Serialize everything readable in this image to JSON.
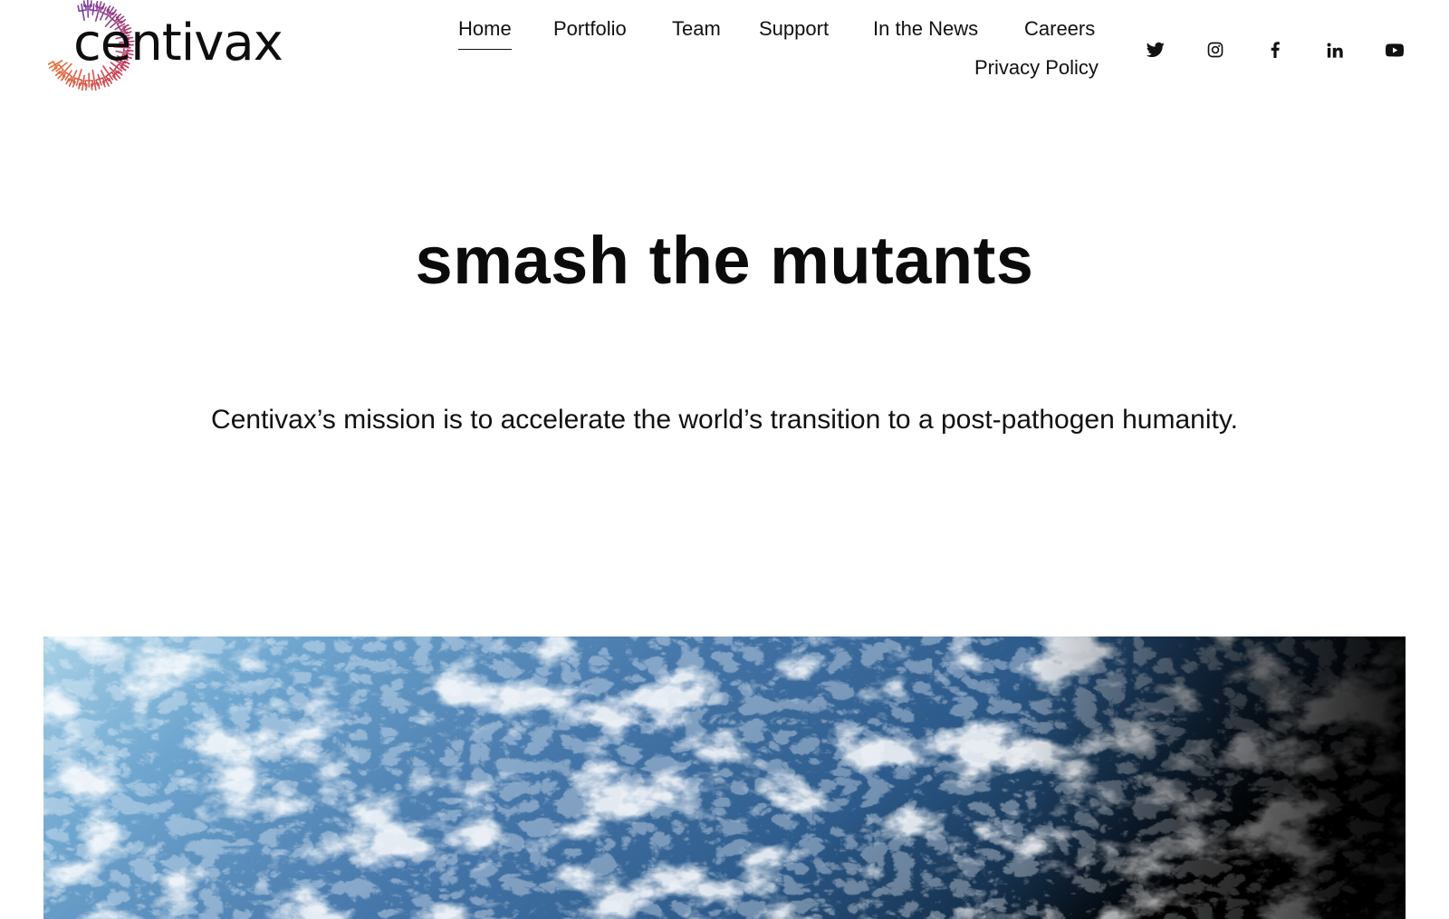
{
  "brand": {
    "name": "centivax"
  },
  "nav": {
    "items": [
      {
        "label": "Home",
        "active": true
      },
      {
        "label": "Portfolio"
      },
      {
        "label": "Team"
      },
      {
        "label": "Support"
      },
      {
        "label": "In the News"
      },
      {
        "label": "Careers"
      },
      {
        "label": "Privacy Policy"
      }
    ]
  },
  "social": [
    "twitter-icon",
    "instagram-icon",
    "facebook-icon",
    "linkedin-icon",
    "youtube-icon"
  ],
  "hero": {
    "title": "smash the mutants",
    "mission": "Centivax’s mission is to accelerate the world’s transition to a post-pathogen humanity."
  },
  "colors": {
    "text": "#111111",
    "logo_gradient": [
      "#7b3fa0",
      "#c2375a",
      "#e8703a"
    ],
    "banner_light": "#a8d0e6",
    "banner_mid": "#3d6e9e",
    "banner_dark": "#000000"
  }
}
